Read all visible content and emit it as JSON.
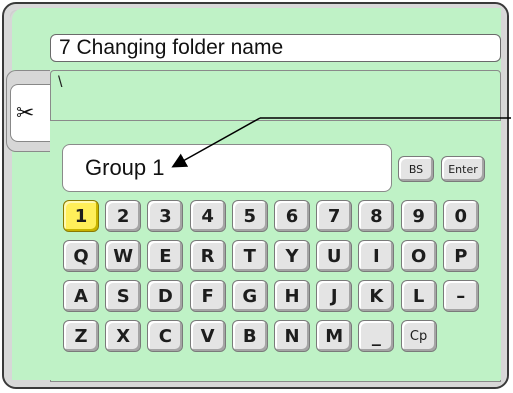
{
  "title": "7 Changing folder name",
  "path": "\\",
  "input_value": "Group 1",
  "buttons": {
    "bs": "BS",
    "enter": "Enter"
  },
  "keyboard": {
    "rows": [
      [
        "1",
        "2",
        "3",
        "4",
        "5",
        "6",
        "7",
        "8",
        "9",
        "0"
      ],
      [
        "Q",
        "W",
        "E",
        "R",
        "T",
        "Y",
        "U",
        "I",
        "O",
        "P"
      ],
      [
        "A",
        "S",
        "D",
        "F",
        "G",
        "H",
        "J",
        "K",
        "L",
        "–"
      ],
      [
        "Z",
        "X",
        "C",
        "V",
        "B",
        "N",
        "M",
        "_",
        "Cp"
      ]
    ],
    "selected_key": "1"
  },
  "side_tab_icon": "scissors-icon",
  "colors": {
    "panel_green": "#bff2c6",
    "selected_key": "#ffef5a"
  }
}
